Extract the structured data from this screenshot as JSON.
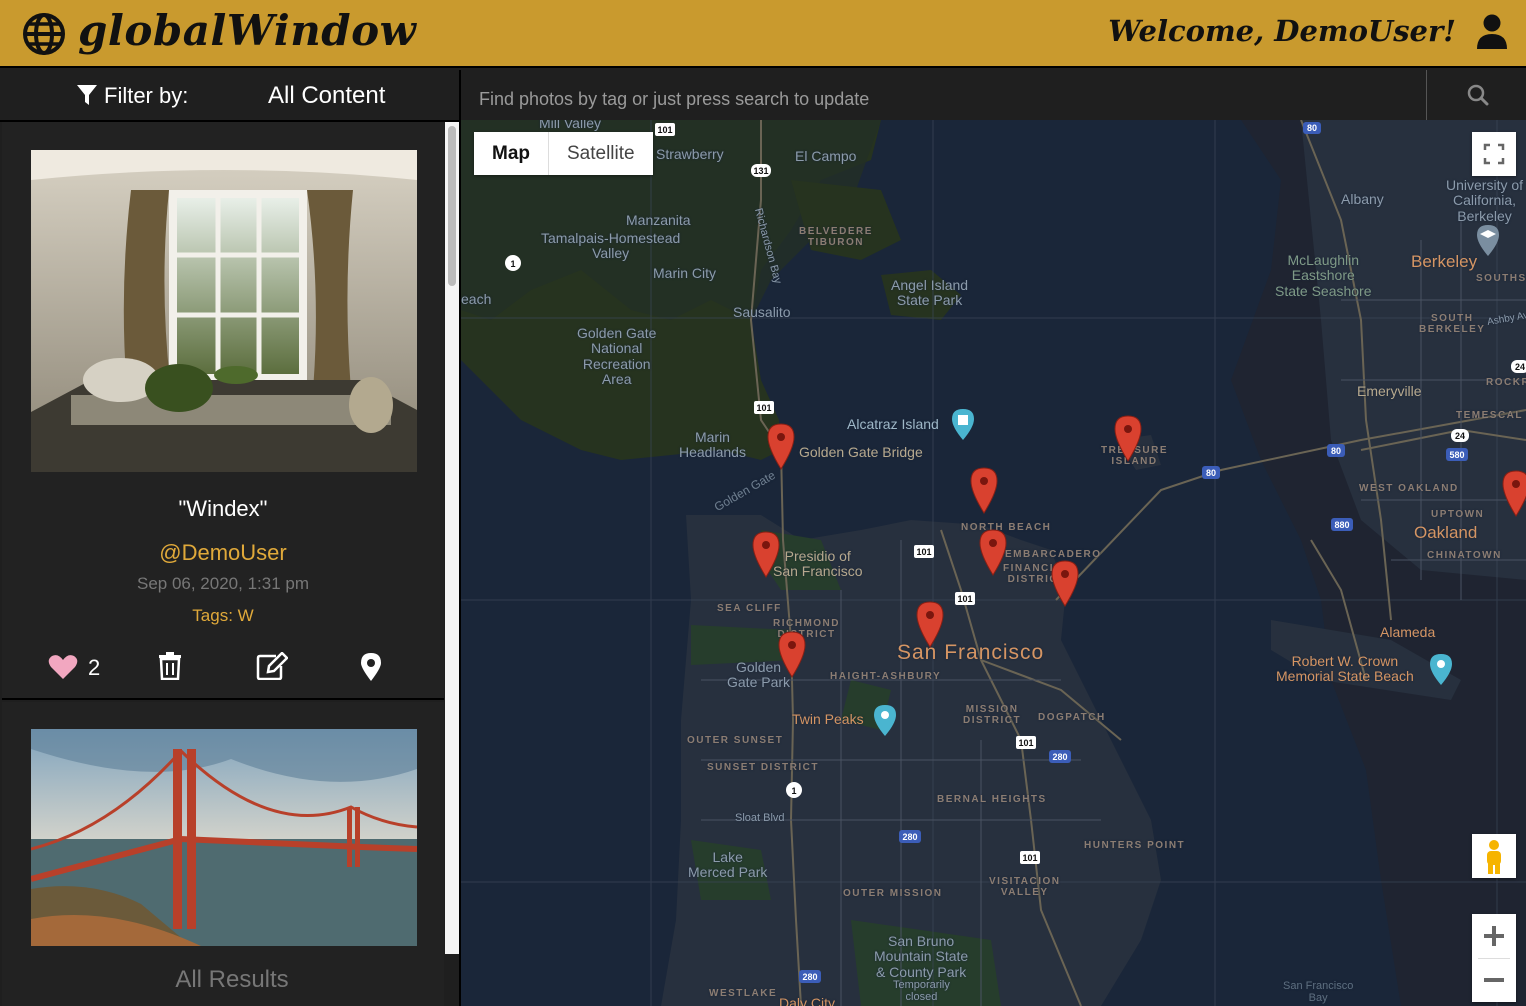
{
  "header": {
    "brand": "globalWindow",
    "welcome": "Welcome, DemoUser!"
  },
  "filter": {
    "label": "Filter by:",
    "value": "All Content"
  },
  "search": {
    "placeholder": "Find photos by tag or just press search to update"
  },
  "posts": [
    {
      "title": "\"Windex\"",
      "user": "@DemoUser",
      "date": "Sep 06, 2020, 1:31 pm",
      "tags": "Tags: W",
      "likes": "2"
    }
  ],
  "sidebar": {
    "all_results": "All Results"
  },
  "map": {
    "type_map": "Map",
    "type_satellite": "Satellite",
    "labels": {
      "mill_valley": "Mill Valley",
      "strawberry": "Strawberry",
      "el_campo": "El Campo",
      "manzanita": "Manzanita",
      "tamalpais": "Tamalpais-Homestead\nValley",
      "marin_city": "Marin City",
      "belvedere": "BELVEDERE\nTIBURON",
      "richardson": "Richardson Bay",
      "sausalito": "Sausalito",
      "angel_island": "Angel Island\nState Park",
      "ggnra": "Golden Gate\nNational\nRecreation\nArea",
      "marin_headlands": "Marin\nHeadlands",
      "alcatraz": "Alcatraz Island",
      "ggb": "Golden Gate Bridge",
      "golden_gate": "Golden Gate",
      "treasure_island": "TREASURE\nISLAND",
      "north_beach": "NORTH BEACH",
      "embarcadero": "EMBARCADERO",
      "financial": "FINANCIAL\nDISTRICT",
      "presidio": "Presidio of\nSan Francisco",
      "sea_cliff": "SEA CLIFF",
      "richmond": "RICHMOND\nDISTRICT",
      "san_francisco": "San Francisco",
      "golden_gate_park": "Golden\nGate Park",
      "haight": "HAIGHT-ASHBURY",
      "twin_peaks": "Twin Peaks",
      "mission": "MISSION\nDISTRICT",
      "dogpatch": "DOGPATCH",
      "outer_sunset": "OUTER SUNSET",
      "sunset": "SUNSET DISTRICT",
      "bernal": "BERNAL HEIGHTS",
      "sloat": "Sloat Blvd",
      "lake_merced": "Lake\nMerced Park",
      "hunters_point": "HUNTERS POINT",
      "outer_mission": "OUTER MISSION",
      "visitacion": "VISITACION\nVALLEY",
      "san_bruno": "San Bruno\nMountain State\n& County Park",
      "temporarily_closed": "Temporarily\nclosed",
      "westlake": "WESTLAKE",
      "daly_city": "Daly City",
      "sf_bay": "San Francisco\nBay",
      "albany": "Albany",
      "uc_berkeley": "University of\nCalifornia,\nBerkeley",
      "mclaughlin": "McLaughlin\nEastshore\nState Seashore",
      "berkeley": "Berkeley",
      "south_berkeley": "SOUTH\nBERKELEY",
      "southside": "SOUTHSIDE",
      "ashby": "Ashby Ave",
      "rockridge": "ROCKRIDGE",
      "emeryville": "Emeryville",
      "temescal": "TEMESCAL",
      "west_oakland": "WEST OAKLAND",
      "uptown": "UPTOWN",
      "oakland": "Oakland",
      "chinatown": "CHINATOWN",
      "alameda": "Alameda",
      "crown_beach": "Robert W. Crown\nMemorial State Beach",
      "beach": "each",
      "highway_101": "101",
      "highway_131": "131",
      "highway_1": "1",
      "highway_80": "80",
      "highway_280": "280",
      "highway_880": "880",
      "highway_580": "580",
      "highway_24": "24"
    }
  },
  "colors": {
    "header_bg": "#c99a2e",
    "accent": "#e0a93a",
    "map_water": "#1a2639",
    "pin": "#d9412f"
  }
}
